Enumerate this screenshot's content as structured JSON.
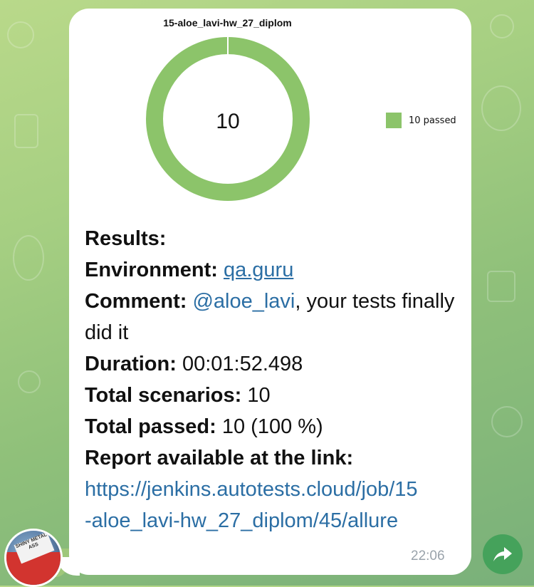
{
  "chart": {
    "title": "15-aloe_lavi-hw_27_diplom",
    "center_value": "10",
    "legend_label": "10 passed",
    "color": "#8cc46a"
  },
  "chart_data": {
    "type": "pie",
    "title": "15-aloe_lavi-hw_27_diplom",
    "categories": [
      "10 passed"
    ],
    "values": [
      10
    ],
    "legend_position": "right"
  },
  "message": {
    "results_label": "Results:",
    "environment_label": "Environment:",
    "environment_link": "qa.guru",
    "comment_label": "Comment:",
    "comment_mention": "@aloe_lavi",
    "comment_text": ", your tests finally did it",
    "duration_label": "Duration:",
    "duration_value": "00:01:52.498",
    "scenarios_label": "Total scenarios:",
    "scenarios_value": "10",
    "passed_label": "Total passed:",
    "passed_value": "10 (100 %)",
    "report_label": "Report available at the link:",
    "report_link": "https://jenkins.autotests.cloud/job/15-aloe_lavi-hw_27_diplom/45/allure",
    "time": "22:06"
  },
  "avatar": {
    "text": "SHINY METAL ASS"
  },
  "icons": {
    "share": "share-icon"
  },
  "colors": {
    "link": "#2b6ea4",
    "share_button": "#45a25b"
  }
}
